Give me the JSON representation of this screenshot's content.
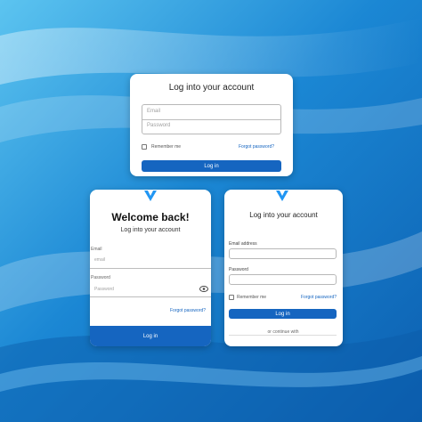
{
  "card_top": {
    "title": "Log into your account",
    "email_placeholder": "Email",
    "password_placeholder": "Password",
    "remember_label": "Remember me",
    "forgot_link": "Forgot password?",
    "login_button": "Log in"
  },
  "card_left": {
    "heading": "Welcome back!",
    "subtitle": "Log into your account",
    "email_label": "Email",
    "email_placeholder": "email",
    "password_label": "Password",
    "password_placeholder": "Password",
    "forgot_link": "Forgot password?",
    "login_button": "Log in"
  },
  "card_right": {
    "title": "Log into your account",
    "email_label": "Email address",
    "password_label": "Password",
    "remember_label": "Remember me",
    "forgot_link": "Forgot password?",
    "login_button": "Log in",
    "alt_text": "or continue with"
  },
  "colors": {
    "accent": "#1565c0",
    "logo": "#2196f3",
    "background": "#1f8fd8"
  },
  "icons": [
    "logo-chevron-icon",
    "eye-icon"
  ]
}
